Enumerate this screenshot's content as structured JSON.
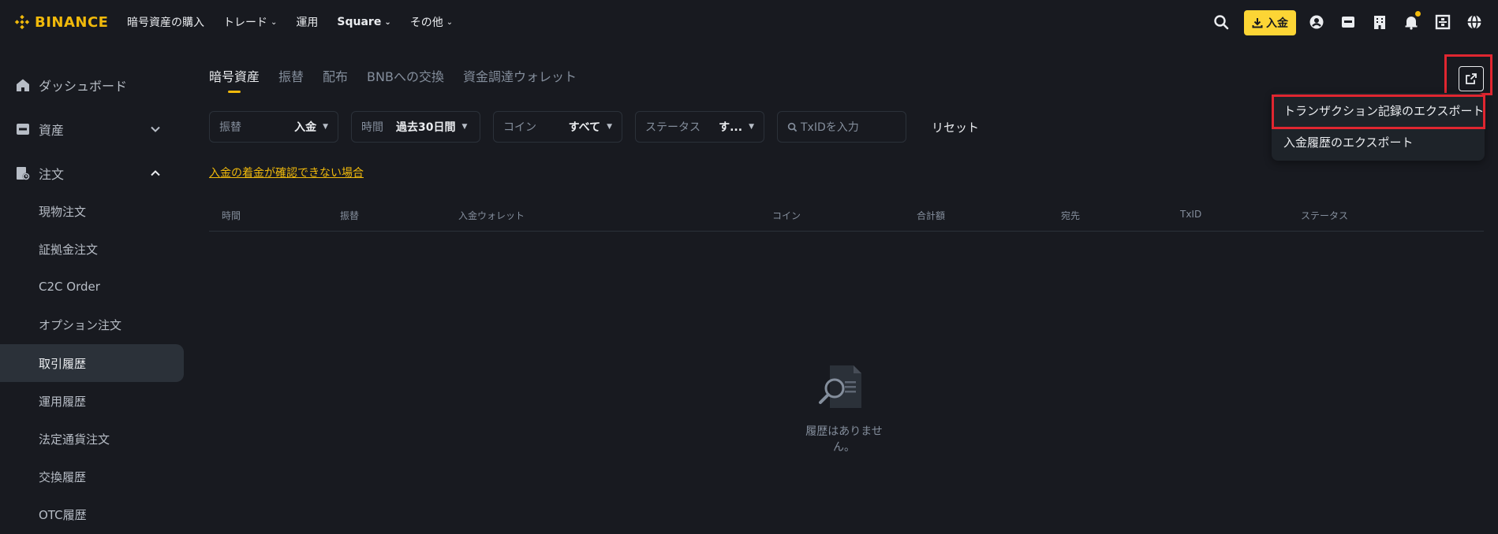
{
  "brand": {
    "name": "BINANCE",
    "color": "#f0b90b"
  },
  "nav": {
    "links": [
      {
        "label": "暗号資産の購入",
        "caret": false,
        "bold": false
      },
      {
        "label": "トレード",
        "caret": true,
        "bold": false
      },
      {
        "label": "運用",
        "caret": false,
        "bold": false
      },
      {
        "label": "Square",
        "caret": true,
        "bold": true
      },
      {
        "label": "その他",
        "caret": true,
        "bold": false
      }
    ],
    "deposit_label": "入金",
    "icons": [
      "search-icon",
      "download-icon",
      "profile-icon",
      "wallet-icon",
      "building-icon",
      "bell-icon",
      "qr-scan-icon",
      "globe-icon"
    ]
  },
  "sidebar": {
    "items": [
      {
        "label": "ダッシュボード",
        "icon": "home-icon"
      },
      {
        "label": "資産",
        "icon": "wallet-icon",
        "chevron": "down"
      },
      {
        "label": "注文",
        "icon": "order-icon",
        "chevron": "up"
      }
    ],
    "sub_items": [
      {
        "label": "現物注文"
      },
      {
        "label": "証拠金注文"
      },
      {
        "label": "C2C Order"
      },
      {
        "label": "オプション注文"
      },
      {
        "label": "取引履歴",
        "active": true
      },
      {
        "label": "運用履歴"
      },
      {
        "label": "法定通貨注文"
      },
      {
        "label": "交換履歴"
      },
      {
        "label": "OTC履歴"
      }
    ]
  },
  "tabs": [
    {
      "label": "暗号資産",
      "active": true
    },
    {
      "label": "振替"
    },
    {
      "label": "配布"
    },
    {
      "label": "BNBへの交換"
    },
    {
      "label": "資金調達ウォレット"
    }
  ],
  "filters": {
    "type": {
      "label": "振替",
      "value": "入金"
    },
    "time": {
      "label": "時間",
      "value": "過去30日間"
    },
    "coin": {
      "label": "コイン",
      "value": "すべて"
    },
    "status": {
      "label": "ステータス",
      "value": "す..."
    },
    "txid_placeholder": "TxIDを入力",
    "reset_label": "リセット"
  },
  "help_link": "入金の着金が確認できない場合",
  "table": {
    "columns": [
      "時間",
      "振替",
      "入金ウォレット",
      "コイン",
      "合計額",
      "宛先",
      "TxID",
      "ステータス"
    ],
    "empty_text": "履歴はありません。"
  },
  "export_menu": {
    "items": [
      "トランザクション記録のエクスポート",
      "入金履歴のエクスポート"
    ]
  },
  "colors": {
    "accent": "#f0b90b",
    "highlight": "#e02630",
    "background": "#181a20"
  }
}
